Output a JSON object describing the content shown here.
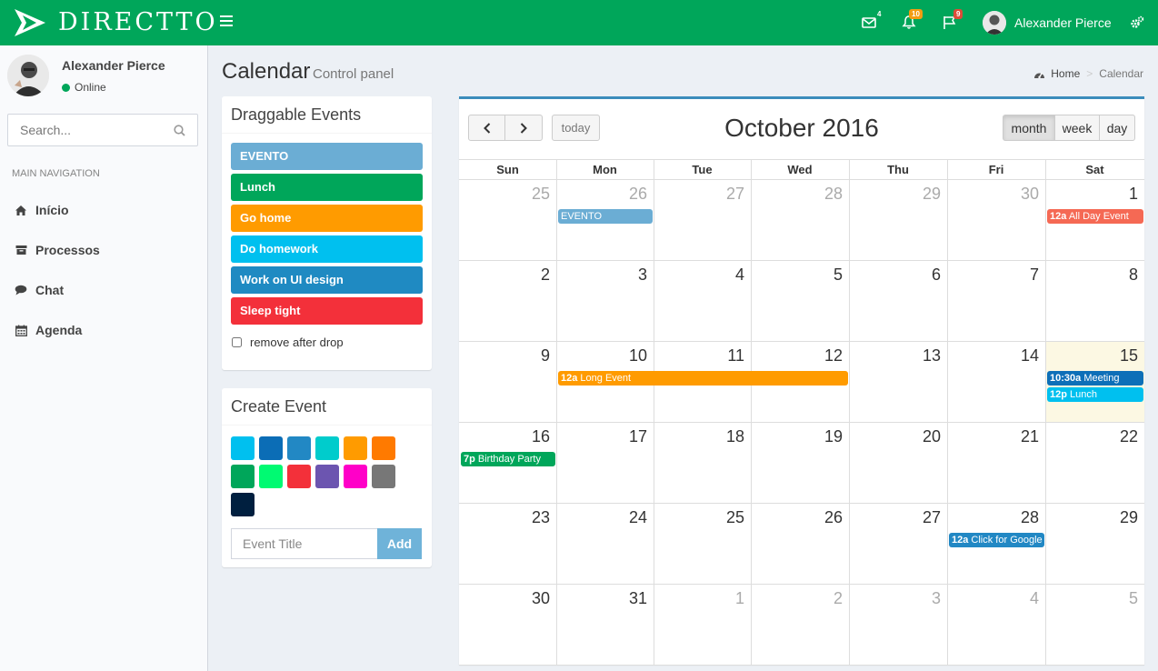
{
  "app": {
    "brand": "DIRECTTO"
  },
  "header": {
    "mail_count": "4",
    "notif_count": "10",
    "flag_count": "9",
    "user_name": "Alexander Pierce"
  },
  "sidebar": {
    "user_name": "Alexander Pierce",
    "status": "Online",
    "search_placeholder": "Search...",
    "nav_header": "MAIN NAVIGATION",
    "items": [
      {
        "label": "Início",
        "icon": "home-icon"
      },
      {
        "label": "Processos",
        "icon": "archive-icon"
      },
      {
        "label": "Chat",
        "icon": "comment-icon"
      },
      {
        "label": "Agenda",
        "icon": "calendar-icon"
      }
    ]
  },
  "page": {
    "title": "Calendar",
    "subtitle": "Control panel",
    "breadcrumb": [
      "Home",
      "Calendar"
    ]
  },
  "draggable": {
    "title": "Draggable Events",
    "events": [
      {
        "label": "EVENTO",
        "color": "#6badd4"
      },
      {
        "label": "Lunch",
        "color": "#00a65a"
      },
      {
        "label": "Go home",
        "color": "#ff9b00"
      },
      {
        "label": "Do homework",
        "color": "#00c0ef"
      },
      {
        "label": "Work on UI design",
        "color": "#1f8ac2"
      },
      {
        "label": "Sleep tight",
        "color": "#f3303a"
      }
    ],
    "remove_label": "remove after drop"
  },
  "create": {
    "title": "Create Event",
    "colors": [
      "#00c0ef",
      "#0b6db6",
      "#2288c4",
      "#00cccc",
      "#ff9b00",
      "#ff7a00",
      "#00a65a",
      "#00fa72",
      "#f3303a",
      "#6c55b0",
      "#ff00c8",
      "#777777",
      "#001f3f"
    ],
    "input_placeholder": "Event Title",
    "add_label": "Add"
  },
  "calendar": {
    "title": "October 2016",
    "today_label": "today",
    "views": [
      "month",
      "week",
      "day"
    ],
    "active_view": "month",
    "weekdays": [
      "Sun",
      "Mon",
      "Tue",
      "Wed",
      "Thu",
      "Fri",
      "Sat"
    ],
    "weeks": [
      [
        "25",
        "26",
        "27",
        "28",
        "29",
        "30",
        "1"
      ],
      [
        "2",
        "3",
        "4",
        "5",
        "6",
        "7",
        "8"
      ],
      [
        "9",
        "10",
        "11",
        "12",
        "13",
        "14",
        "15"
      ],
      [
        "16",
        "17",
        "18",
        "19",
        "20",
        "21",
        "22"
      ],
      [
        "23",
        "24",
        "25",
        "26",
        "27",
        "28",
        "29"
      ],
      [
        "30",
        "31",
        "1",
        "2",
        "3",
        "4",
        "5"
      ]
    ],
    "events": [
      {
        "time": "",
        "title": "EVENTO",
        "color": "#6badd4"
      },
      {
        "time": "12a",
        "title": "All Day Event",
        "color": "#f56954"
      },
      {
        "time": "12a",
        "title": "Long Event",
        "color": "#ff9b00"
      },
      {
        "time": "10:30a",
        "title": "Meeting",
        "color": "#0d6fb8"
      },
      {
        "time": "12p",
        "title": "Lunch",
        "color": "#00c0ef"
      },
      {
        "time": "7p",
        "title": "Birthday Party",
        "color": "#00a65a"
      },
      {
        "time": "12a",
        "title": "Click for Google",
        "color": "#2288c4"
      }
    ]
  }
}
